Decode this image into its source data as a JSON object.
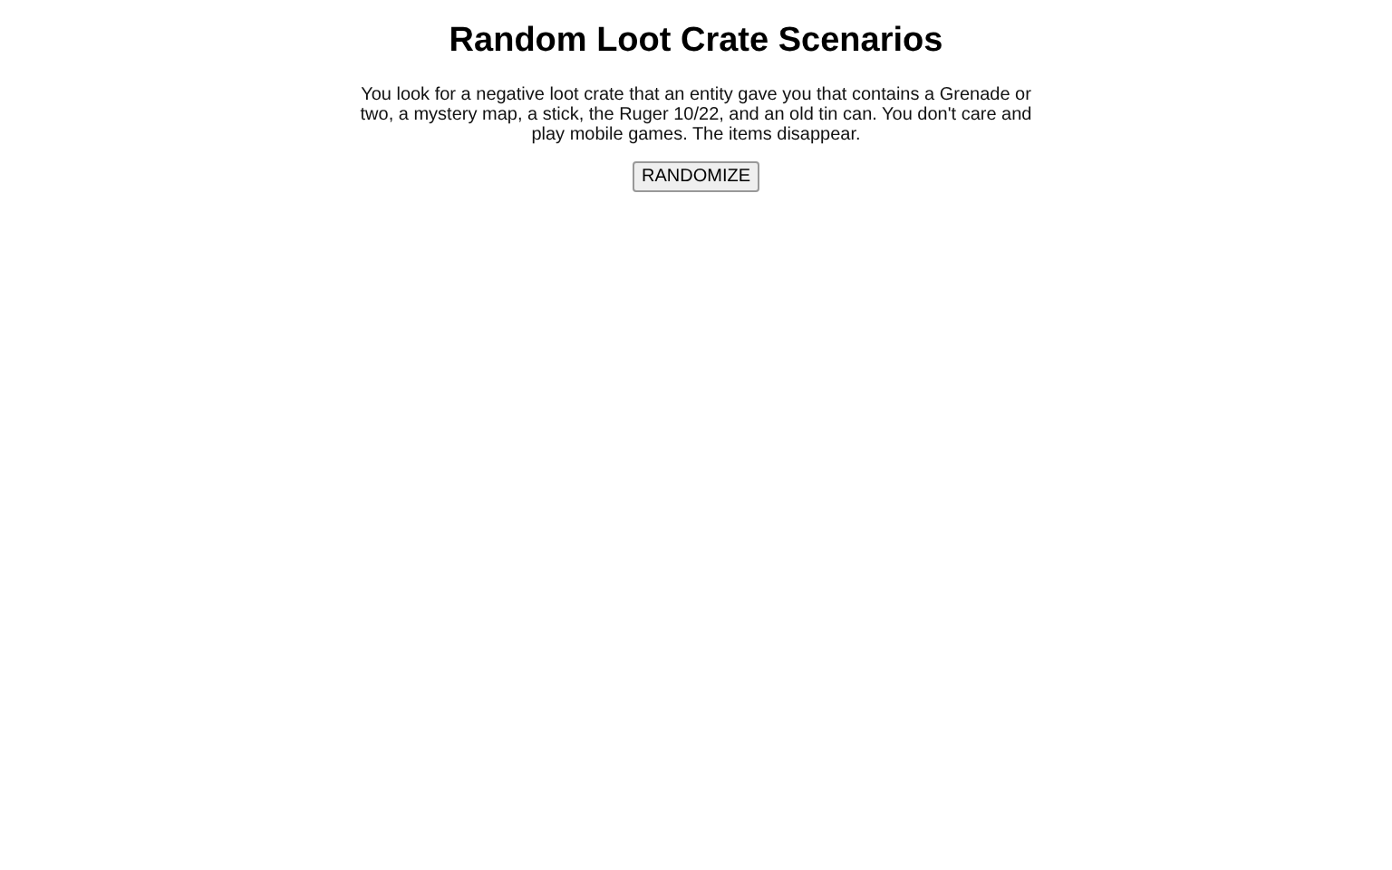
{
  "title": "Random Loot Crate Scenarios",
  "scenario": "You look for a negative loot crate that an entity gave you that contains a Grenade or two, a mystery map, a stick, the Ruger 10/22, and an old tin can. You don't care and play mobile games. The items disappear.",
  "button": "RANDOMIZE"
}
